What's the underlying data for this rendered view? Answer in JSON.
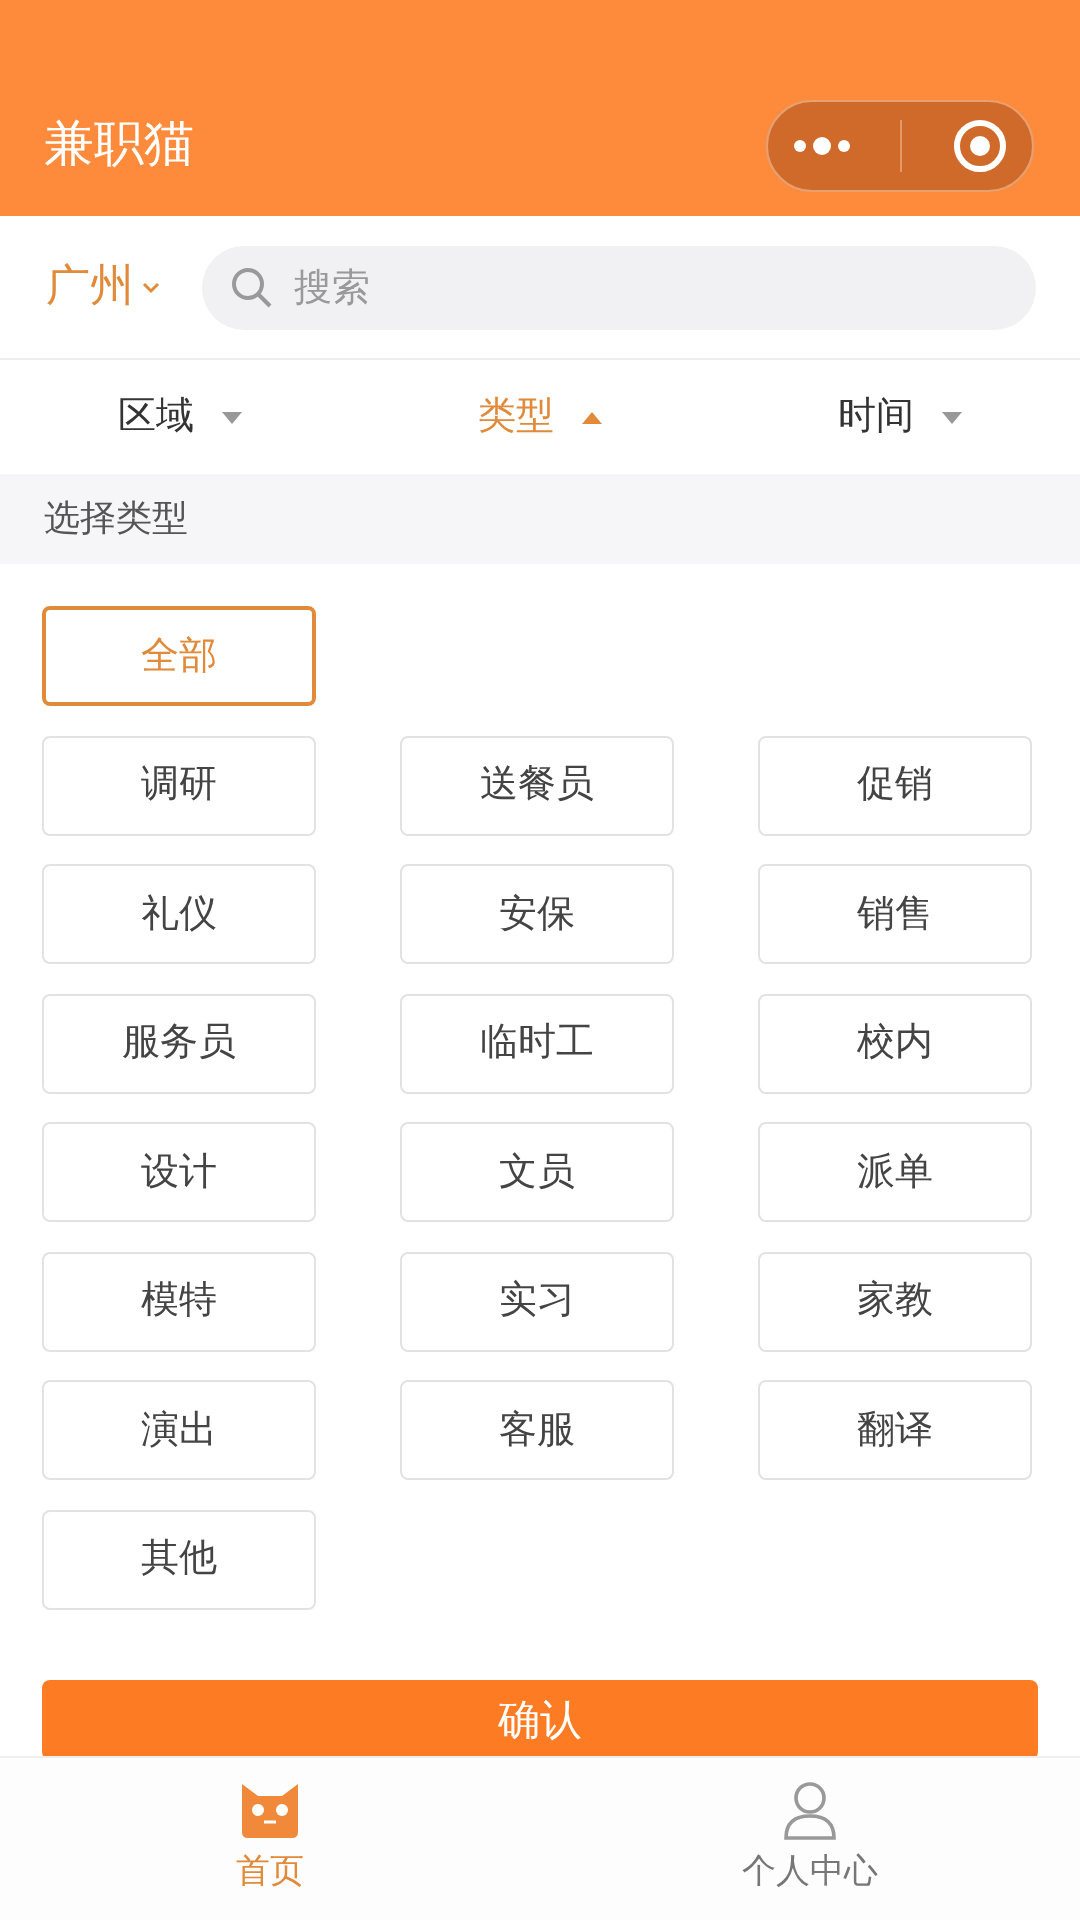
{
  "header": {
    "title": "兼职猫"
  },
  "city": {
    "label": "广州"
  },
  "search": {
    "placeholder": "搜索"
  },
  "filters": [
    {
      "label": "区域",
      "selected": false
    },
    {
      "label": "类型",
      "selected": true
    },
    {
      "label": "时间",
      "selected": false
    }
  ],
  "section_title": "选择类型",
  "types": [
    {
      "label": "全部",
      "selected": true
    },
    {
      "label": "调研",
      "selected": false
    },
    {
      "label": "送餐员",
      "selected": false
    },
    {
      "label": "促销",
      "selected": false
    },
    {
      "label": "礼仪",
      "selected": false
    },
    {
      "label": "安保",
      "selected": false
    },
    {
      "label": "销售",
      "selected": false
    },
    {
      "label": "服务员",
      "selected": false
    },
    {
      "label": "临时工",
      "selected": false
    },
    {
      "label": "校内",
      "selected": false
    },
    {
      "label": "设计",
      "selected": false
    },
    {
      "label": "文员",
      "selected": false
    },
    {
      "label": "派单",
      "selected": false
    },
    {
      "label": "模特",
      "selected": false
    },
    {
      "label": "实习",
      "selected": false
    },
    {
      "label": "家教",
      "selected": false
    },
    {
      "label": "演出",
      "selected": false
    },
    {
      "label": "客服",
      "selected": false
    },
    {
      "label": "翻译",
      "selected": false
    },
    {
      "label": "其他",
      "selected": false
    }
  ],
  "confirm_button": "确认",
  "tab_bar": [
    {
      "label": "首页",
      "kind": "cat",
      "selected": true
    },
    {
      "label": "个人中心",
      "kind": "person",
      "selected": false
    }
  ]
}
